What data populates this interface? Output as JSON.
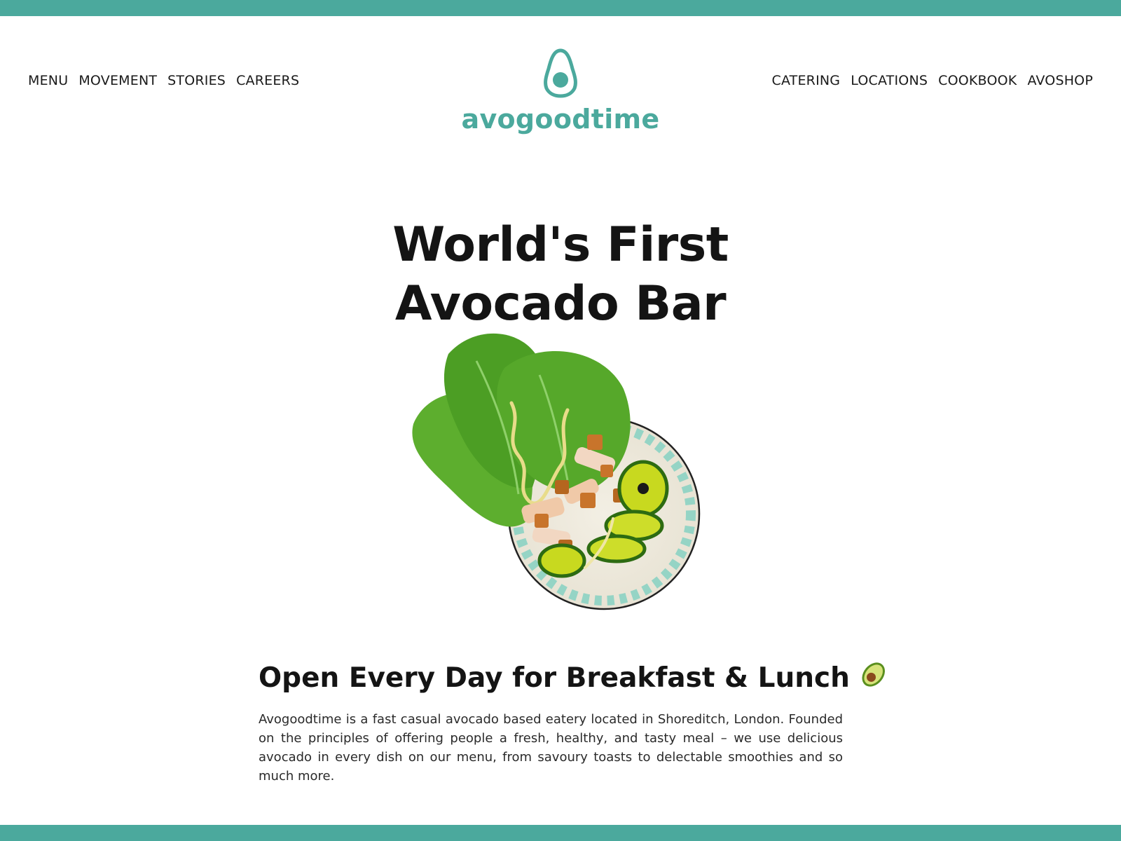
{
  "brand": {
    "name": "avogoodtime",
    "color": "#4ba99d",
    "logo_icon": "avocado-icon"
  },
  "nav": {
    "left": [
      "MENU",
      "MOVEMENT",
      "STORIES",
      "CAREERS"
    ],
    "right": [
      "CATERING",
      "LOCATIONS",
      "COOKBOOK",
      "AVOSHOP"
    ]
  },
  "hero": {
    "title_line1": "World's First",
    "title_line2": "Avocado Bar",
    "image": "avocado-salad-bowl"
  },
  "about": {
    "heading": "Open Every Day for Breakfast & Lunch",
    "heading_icon": "avocado-emoji",
    "body": "Avogoodtime is a fast casual avocado based eatery located in Shoreditch, London. Founded on the principles of offering people a fresh, healthy, and tasty meal – we use delicious avocado in every dish on our menu, from savoury toasts to delectable smoothies and so much more."
  }
}
